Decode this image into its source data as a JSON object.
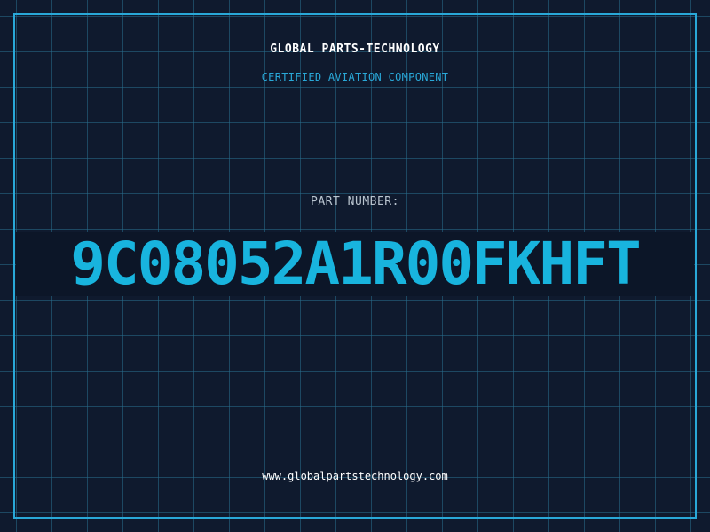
{
  "header": {
    "company_name": "GLOBAL PARTS-TECHNOLOGY",
    "subtitle": "CERTIFIED AVIATION COMPONENT"
  },
  "part": {
    "label": "PART NUMBER:",
    "number": "9C08052A1R00FKHFT"
  },
  "footer": {
    "website": "www.globalpartstechnology.com"
  },
  "colors": {
    "background": "#0f1a2e",
    "grid": "#286e8c",
    "accent": "#29a8d8",
    "part_number": "#18b4de",
    "text_light": "#ffffff"
  }
}
